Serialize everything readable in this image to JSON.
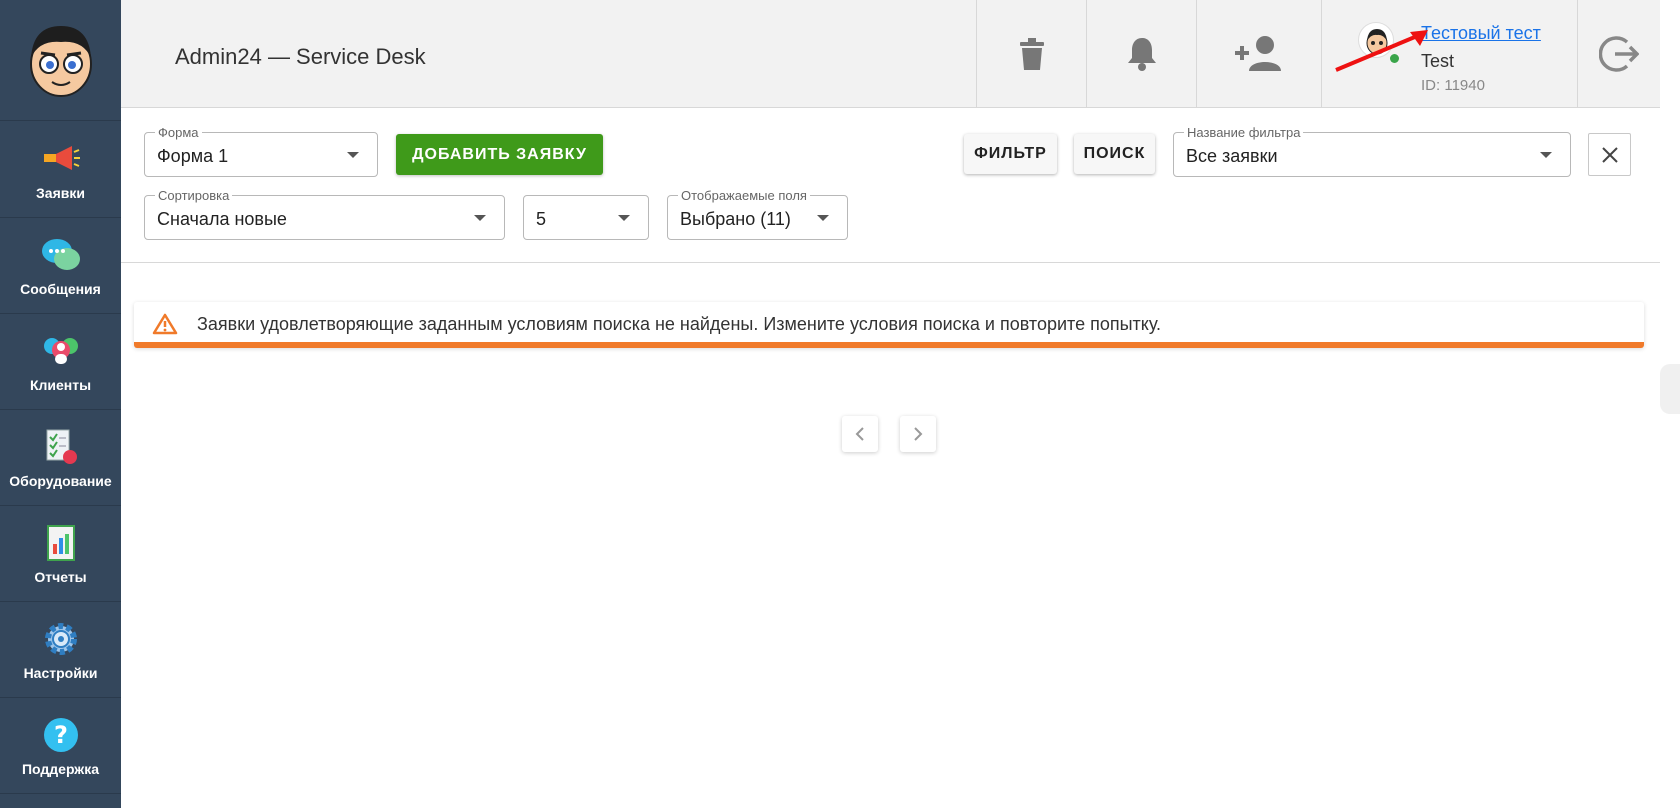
{
  "app": {
    "title": "Admin24 — Service Desk"
  },
  "sidebar": {
    "items": [
      {
        "label": "Заявки",
        "icon": "megaphone-icon"
      },
      {
        "label": "Сообщения",
        "icon": "chat-bubbles-icon"
      },
      {
        "label": "Клиенты",
        "icon": "clients-icon"
      },
      {
        "label": "Оборудование",
        "icon": "equipment-checklist-icon"
      },
      {
        "label": "Отчеты",
        "icon": "report-chart-icon"
      },
      {
        "label": "Настройки",
        "icon": "gear-icon"
      },
      {
        "label": "Поддержка",
        "icon": "help-question-icon"
      }
    ]
  },
  "header": {
    "icons": [
      "trash-icon",
      "bell-icon",
      "add-user-icon",
      "logout-icon"
    ],
    "user": {
      "name": "Тестовый тест",
      "login": "Test",
      "id": "ID: 11940"
    }
  },
  "filters": {
    "form": {
      "label": "Форма",
      "value": "Форма 1"
    },
    "add_button": "ДОБАВИТЬ ЗАЯВКУ",
    "filter_button": "ФИЛЬТР",
    "search_button": "ПОИСК",
    "filter_name": {
      "label": "Название фильтра",
      "value": "Все заявки"
    },
    "sort": {
      "label": "Сортировка",
      "value": "Сначала новые"
    },
    "page_size": {
      "value": "5"
    },
    "fields": {
      "label": "Отображаемые поля",
      "value": "Выбрано (11)"
    }
  },
  "alert": {
    "text": "Заявки удовлетворяющие заданным условиям поиска не найдены. Измените условия поиска и повторите попытку.",
    "color": "#f07a2a"
  },
  "colors": {
    "sidebar": "#34475c",
    "primary_button": "#3f9a1a",
    "link": "#1a73e8"
  }
}
